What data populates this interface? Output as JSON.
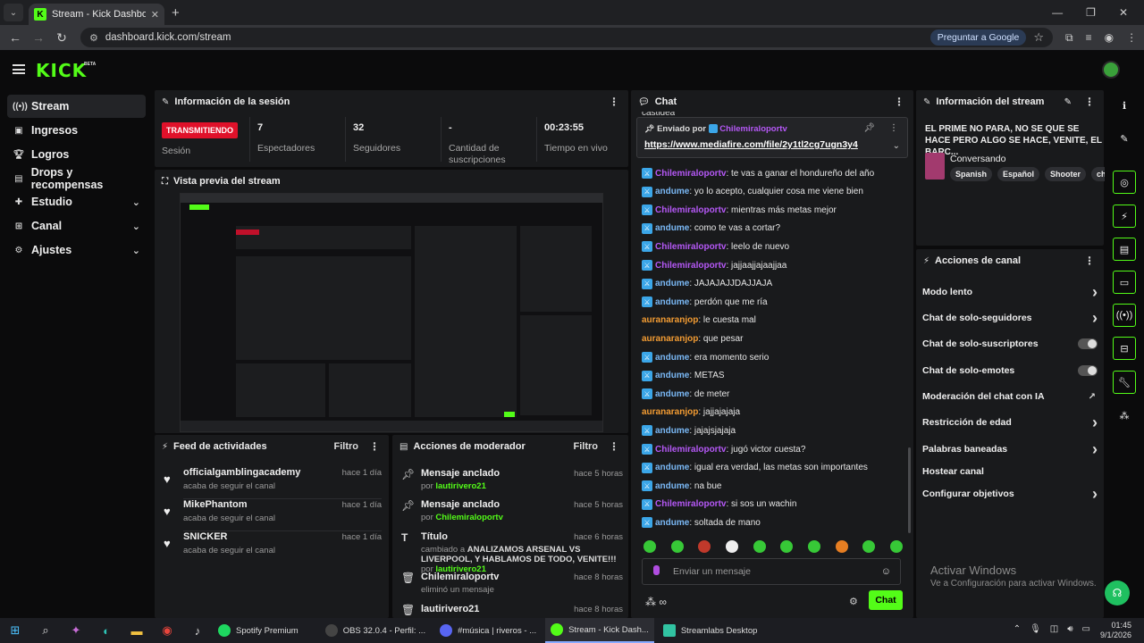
{
  "browser": {
    "tab_title": "Stream - Kick Dashboard",
    "url": "dashboard.kick.com/stream",
    "ask_google": "Preguntar a Google"
  },
  "app": {
    "logo": "KICK",
    "beta": "BETA"
  },
  "sidebar": {
    "items": [
      {
        "label": "Stream"
      },
      {
        "label": "Ingresos"
      },
      {
        "label": "Logros"
      },
      {
        "label": "Drops y recompensas"
      },
      {
        "label": "Estudio"
      },
      {
        "label": "Canal"
      },
      {
        "label": "Ajustes"
      }
    ]
  },
  "session": {
    "title": "Información de la sesión",
    "status": "TRANSMITIENDO",
    "status_label": "Sesión",
    "viewers": "7",
    "viewers_label": "Espectadores",
    "followers": "32",
    "followers_label": "Seguidores",
    "subs": "-",
    "subs_label": "Cantidad de suscripciones",
    "time": "00:23:55",
    "time_label": "Tiempo en vivo"
  },
  "preview": {
    "title": "Vista previa del stream"
  },
  "feed": {
    "title": "Feed de actividades",
    "filter": "Filtro",
    "items": [
      {
        "name": "officialgamblingacademy",
        "sub": "acaba de seguir el canal",
        "time": "hace 1 día"
      },
      {
        "name": "MikePhantom",
        "sub": "acaba de seguir el canal",
        "time": "hace 1 día"
      },
      {
        "name": "SNICKER",
        "sub": "acaba de seguir el canal",
        "time": "hace 1 día"
      }
    ]
  },
  "mod": {
    "title": "Acciones de moderador",
    "filter": "Filtro",
    "items": [
      {
        "title": "Mensaje anclado",
        "time": "hace 5 horas",
        "by": "por",
        "user": "lautirivero21"
      },
      {
        "title": "Mensaje anclado",
        "time": "hace 5 horas",
        "by": "por",
        "user": "Chilemiraloportv"
      },
      {
        "title": "Título",
        "time": "hace 6 horas",
        "pre": "cambiado a",
        "text": "ANALIZAMOS ARSENAL VS LIVERPOOL, Y HABLAMOS DE TODO, VENITE!!!",
        "by": "por",
        "user": "lautirivero21"
      },
      {
        "title": "Chilemiraloportv",
        "time": "hace 8 horas",
        "sub": "eliminó un mensaje"
      },
      {
        "title": "lautirivero21",
        "time": "hace 8 horas"
      }
    ]
  },
  "chat": {
    "title": "Chat",
    "cut_text": "castidea",
    "pinned_by": "Enviado por",
    "pinned_user": "Chilemiraloportv",
    "pinned_link": "https://www.mediafire.com/file/2y1tl2cg7ugn3y4",
    "messages": [
      {
        "user": "Chilemiraloportv",
        "text": ": te vas a ganar el hondureño del año",
        "color": "#b558f6",
        "badge": true
      },
      {
        "user": "andume",
        "text": ": yo lo acepto, cualquier cosa me viene bien",
        "color": "#7ab8f5",
        "badge": true
      },
      {
        "user": "Chilemiraloportv",
        "text": ": mientras más metas mejor",
        "color": "#b558f6",
        "badge": true
      },
      {
        "user": "andume",
        "text": ": como te vas a cortar?",
        "color": "#7ab8f5",
        "badge": true
      },
      {
        "user": "Chilemiraloportv",
        "text": ": leelo de nuevo",
        "color": "#b558f6",
        "badge": true
      },
      {
        "user": "Chilemiraloportv",
        "text": ": jajjaajjajaajjaa",
        "color": "#b558f6",
        "badge": true
      },
      {
        "user": "andume",
        "text": ": JAJAJAJJDAJJAJA",
        "color": "#7ab8f5",
        "badge": true
      },
      {
        "user": "andume",
        "text": ": perdón que me ría",
        "color": "#7ab8f5",
        "badge": true
      },
      {
        "user": "auranaranjop",
        "text": ": le cuesta mal",
        "color": "#f39c33",
        "badge": false
      },
      {
        "user": "auranaranjop",
        "text": ": que pesar",
        "color": "#f39c33",
        "badge": false
      },
      {
        "user": "andume",
        "text": ": era momento serio",
        "color": "#7ab8f5",
        "badge": true
      },
      {
        "user": "andume",
        "text": ": METAS",
        "color": "#7ab8f5",
        "badge": true
      },
      {
        "user": "andume",
        "text": ": de meter",
        "color": "#7ab8f5",
        "badge": true
      },
      {
        "user": "auranaranjop",
        "text": ": jajjajajaja",
        "color": "#f39c33",
        "badge": false
      },
      {
        "user": "andume",
        "text": ": jajajsjajaja",
        "color": "#7ab8f5",
        "badge": true
      },
      {
        "user": "Chilemiraloportv",
        "text": ": jugó victor cuesta?",
        "color": "#b558f6",
        "badge": true
      },
      {
        "user": "andume",
        "text": ": igual era verdad, las metas son importantes",
        "color": "#7ab8f5",
        "badge": true
      },
      {
        "user": "andume",
        "text": ": na bue",
        "color": "#7ab8f5",
        "badge": true
      },
      {
        "user": "Chilemiraloportv",
        "text": ": si sos un wachin",
        "color": "#b558f6",
        "badge": true
      },
      {
        "user": "andume",
        "text": ": soltada de mano",
        "color": "#7ab8f5",
        "badge": true
      }
    ],
    "placeholder": "Enviar un mensaje",
    "send": "Chat"
  },
  "stream_info": {
    "title": "Información del stream",
    "stream_title": "EL PRIME NO PARA, NO SE QUE SE HACE PERO ALGO SE HACE, VENITE, EL BARC...",
    "category": "Conversando",
    "tags": [
      "Spanish",
      "Español",
      "Shooter",
      "chill"
    ]
  },
  "channel_actions": {
    "title": "Acciones de canal",
    "items": [
      {
        "label": "Modo lento",
        "kind": "chev"
      },
      {
        "label": "Chat de solo-seguidores",
        "kind": "chev"
      },
      {
        "label": "Chat de solo-suscriptores",
        "kind": "toggle"
      },
      {
        "label": "Chat de solo-emotes",
        "kind": "toggle"
      },
      {
        "label": "Moderación del chat con IA",
        "kind": "ext"
      },
      {
        "label": "Restricción de edad",
        "kind": "chev"
      },
      {
        "label": "Palabras baneadas",
        "kind": "chev"
      },
      {
        "label": "Hostear canal",
        "kind": "none"
      },
      {
        "label": "Configurar objetivos",
        "kind": "chev"
      }
    ]
  },
  "watermark": {
    "line1": "Activar Windows",
    "line2": "Ve a Configuración para activar Windows."
  },
  "taskbar": {
    "apps": [
      {
        "label": "Spotify Premium",
        "color": "#1ed760"
      },
      {
        "label": "OBS 32.0.4 - Perfil: ...",
        "color": "#2a2a2a"
      },
      {
        "label": "#música | riveros - ...",
        "color": "#5865f2"
      },
      {
        "label": "Stream - Kick Dash...",
        "color": "#53fc18"
      },
      {
        "label": "Streamlabs Desktop",
        "color": "#31c3a2"
      }
    ],
    "time": "01:45",
    "date": "9/1/2026"
  }
}
